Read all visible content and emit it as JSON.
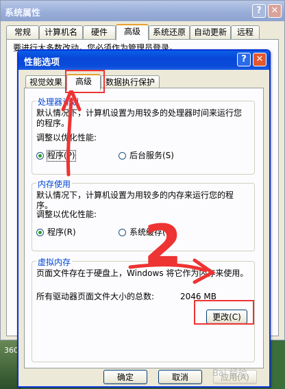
{
  "outer": {
    "title": "系统属性",
    "help": "?",
    "close": "✕",
    "tabs": [
      "常规",
      "计算机名",
      "硬件",
      "高级",
      "系统还原",
      "自动更新",
      "远程"
    ],
    "active_tab": "高级",
    "hint": "要进行大多数改动，您必须作为管理员登录。"
  },
  "inner": {
    "title": "性能选项",
    "help": "?",
    "close": "✕",
    "tabs": [
      "视觉效果",
      "高级",
      "数据执行保护"
    ],
    "active_tab": "高级",
    "processor": {
      "title": "处理器计划",
      "desc": "默认情况下，计算机设置为用较多的处理器时间来运行您的程序。",
      "adjust": "调整以优化性能:",
      "opt1": "程序(P)",
      "opt2": "后台服务(S)",
      "selected": "程序(P)"
    },
    "memory": {
      "title": "内存使用",
      "desc": "默认情况下，计算机设置为用较多的内存来运行您的程序。",
      "adjust": "调整以优化性能:",
      "opt1": "程序(R)",
      "opt2": "系统缓存(T)",
      "selected": "程序(R)"
    },
    "virtual": {
      "title": "虚拟内存",
      "desc": "页面文件存在于硬盘上，Windows 将它作为内存来使用。",
      "total_label": "所有驱动器页面文件大小的总数:",
      "total_value": "2046 MB",
      "change_button": "更改(C)"
    },
    "buttons": {
      "ok": "确定",
      "cancel": "取消",
      "apply": "应用(A)"
    }
  },
  "annotation": {
    "number": "2"
  },
  "watermark": "Bai 经验",
  "desktop_label": "360",
  "colors": {
    "annotation": "#e33333",
    "xp_blue": "#0a4cd9",
    "group_title": "#0046d5"
  }
}
